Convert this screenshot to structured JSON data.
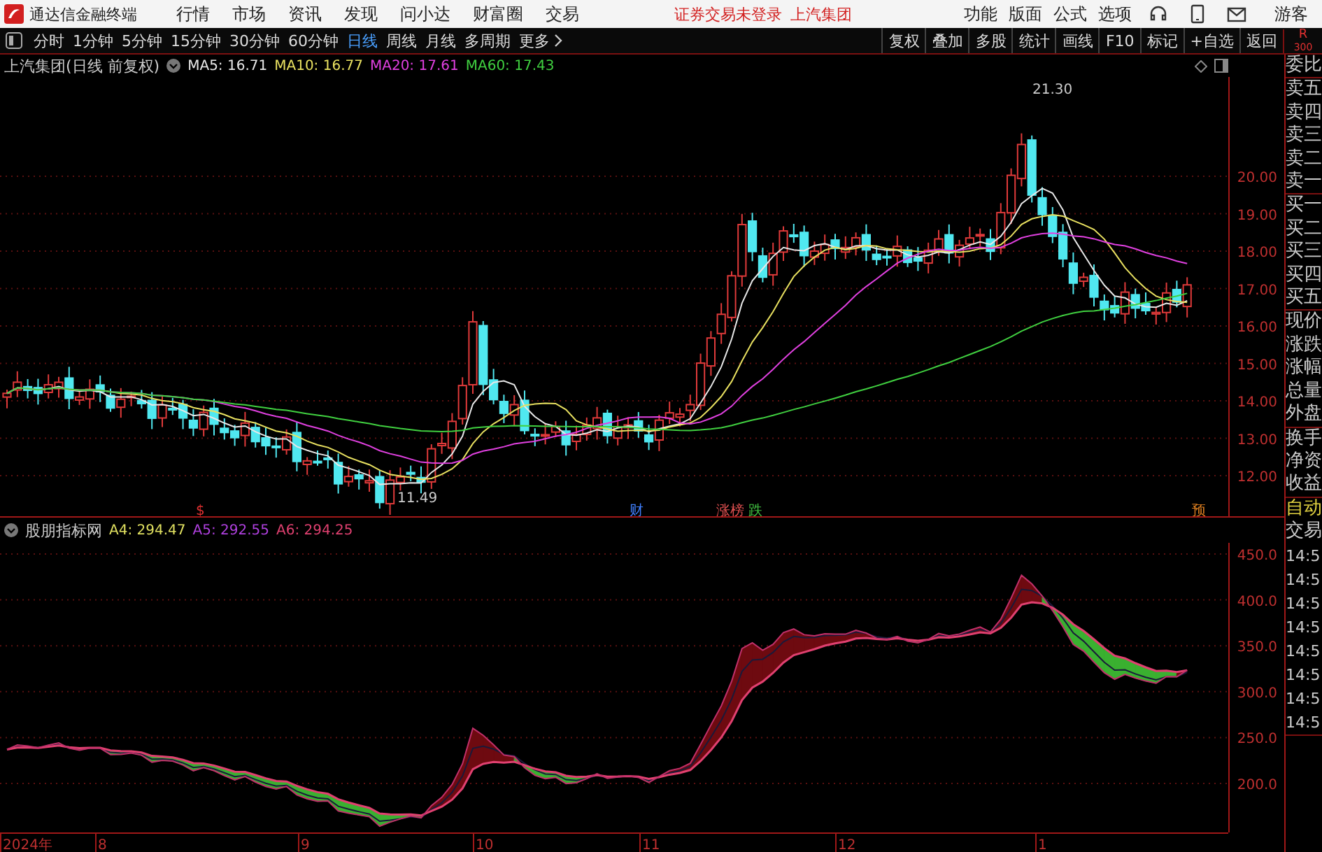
{
  "app": {
    "title": "通达信金融终端"
  },
  "menu": [
    "行情",
    "市场",
    "资讯",
    "发现",
    "问小达",
    "财富圈",
    "交易"
  ],
  "login_notice": "证券交易未登录",
  "stock_name": "上汽集团",
  "top_actions": [
    "功能",
    "版面",
    "公式",
    "选项"
  ],
  "user": "游客",
  "periods": [
    {
      "label": "分时",
      "selected": false
    },
    {
      "label": "1分钟",
      "selected": false
    },
    {
      "label": "5分钟",
      "selected": false
    },
    {
      "label": "15分钟",
      "selected": false
    },
    {
      "label": "30分钟",
      "selected": false
    },
    {
      "label": "60分钟",
      "selected": false
    },
    {
      "label": "日线",
      "selected": true
    },
    {
      "label": "周线",
      "selected": false
    },
    {
      "label": "月线",
      "selected": false
    },
    {
      "label": "多周期",
      "selected": false
    },
    {
      "label": "更多",
      "selected": false
    }
  ],
  "tools": [
    "复权",
    "叠加",
    "多股",
    "统计",
    "画线",
    "F10",
    "标记",
    "+自选",
    "返回"
  ],
  "panel_header": {
    "line_1": "R",
    "line_2": "300"
  },
  "price_chart": {
    "title": "上汽集团(日线 前复权)",
    "indicators": [
      {
        "label": "MA5: 16.71",
        "color": "#e8e8e8"
      },
      {
        "label": "MA10: 16.77",
        "color": "#e8e060"
      },
      {
        "label": "MA20: 17.61",
        "color": "#e040e0"
      },
      {
        "label": "MA60: 17.43",
        "color": "#40d040"
      }
    ],
    "high_label": "21.30",
    "low_label": "11.49",
    "axis": [
      "20.00",
      "19.00",
      "18.00",
      "17.00",
      "16.00",
      "15.00",
      "14.00",
      "13.00",
      "12.00"
    ],
    "markers": [
      {
        "text": "$",
        "color": "#e03030"
      },
      {
        "text": "财",
        "color": "#4080ff"
      },
      {
        "text": "涨榜",
        "color": "#e05050"
      },
      {
        "text": "跌",
        "color": "#40c040"
      },
      {
        "text": "预",
        "color": "#e08020"
      }
    ]
  },
  "indicator_chart": {
    "title": "股朋指标网",
    "values": [
      {
        "label": "A4: 294.47",
        "color": "#e0e060"
      },
      {
        "label": "A5: 292.55",
        "color": "#b040e0"
      },
      {
        "label": "A6: 294.25",
        "color": "#e04070"
      }
    ],
    "axis": [
      "450.0",
      "400.0",
      "350.0",
      "300.0",
      "250.0",
      "200.0"
    ]
  },
  "date_axis": [
    "2024年",
    "8",
    "9",
    "10",
    "11",
    "12",
    "1"
  ],
  "quote_panel": [
    [
      "委比"
    ],
    [
      "卖五",
      "卖四",
      "卖三",
      "卖二",
      "卖一"
    ],
    [
      "买一",
      "买二",
      "买三",
      "买四",
      "买五"
    ],
    [
      "现价",
      "涨跌",
      "涨幅",
      "总量",
      "外盘"
    ],
    [
      "换手",
      "净资",
      "收益"
    ]
  ],
  "trade_panel": {
    "mode": "自动",
    "title": "交易",
    "times": [
      "14:5",
      "14:5",
      "14:5",
      "14:5",
      "14:5",
      "14:5",
      "14:5",
      "14:5"
    ]
  }
}
